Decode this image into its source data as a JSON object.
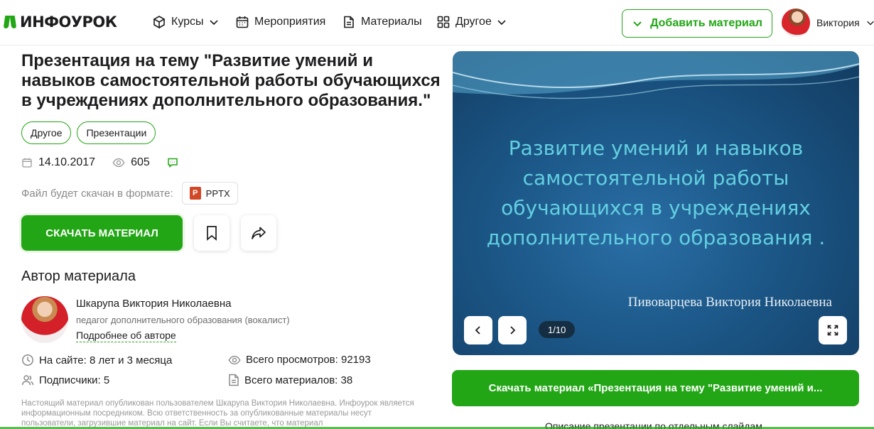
{
  "header": {
    "logo_text": "ИНФОУРОК",
    "nav": [
      {
        "label": "Курсы",
        "icon": "cube-icon",
        "has_chevron": true
      },
      {
        "label": "Мероприятия",
        "icon": "calendar-icon",
        "has_chevron": false
      },
      {
        "label": "Материалы",
        "icon": "document-icon",
        "has_chevron": false
      },
      {
        "label": "Другое",
        "icon": "grid-icon",
        "has_chevron": true
      }
    ],
    "add_button_label": "Добавить материал",
    "user_name": "Виктория"
  },
  "material": {
    "title": "Презентация на тему \"Развитие умений и навыков самостоятельной работы обучающихся в учреждениях дополнительного образования.\"",
    "tags": [
      "Другое",
      "Презентации"
    ],
    "date": "14.10.2017",
    "views": "605",
    "format_label": "Файл будет скачан в формате:",
    "format": "PPTX",
    "download_label": "СКАЧАТЬ МАТЕРИАЛ"
  },
  "author": {
    "section_title": "Автор материала",
    "name": "Шкарупа Виктория Николаевна",
    "role": "педагог дополнительного образования (вокалист)",
    "more_link": "Подробнее об авторе",
    "on_site": "На сайте: 8 лет и 3 месяца",
    "total_views": "Всего просмотров: 92193",
    "subscribers": "Подписчики: 5",
    "total_materials": "Всего материалов: 38"
  },
  "disclaimer": "Настоящий материал опубликован пользователем Шкарупа Виктория Николаевна. Инфоурок является информационным посредником. Всю ответственность за опубликованные материалы несут пользователи, загрузившие материал на сайт. Если Вы считаете, что материал",
  "slide": {
    "text": "Развитие умений и навыков самостоятельной работы обучающихся в учреждениях дополнительного образования .",
    "author": "Пивоварцева Виктория Николаевна",
    "counter": "1/10"
  },
  "download_full_label": "Скачать материал «Презентация на тему \"Развитие умений и...",
  "slides_description_link": "Описание презентации по отдельным слайдам",
  "colors": {
    "accent": "#22a615",
    "slide_text": "#63cfe0",
    "slide_bg": "#1b5686"
  }
}
